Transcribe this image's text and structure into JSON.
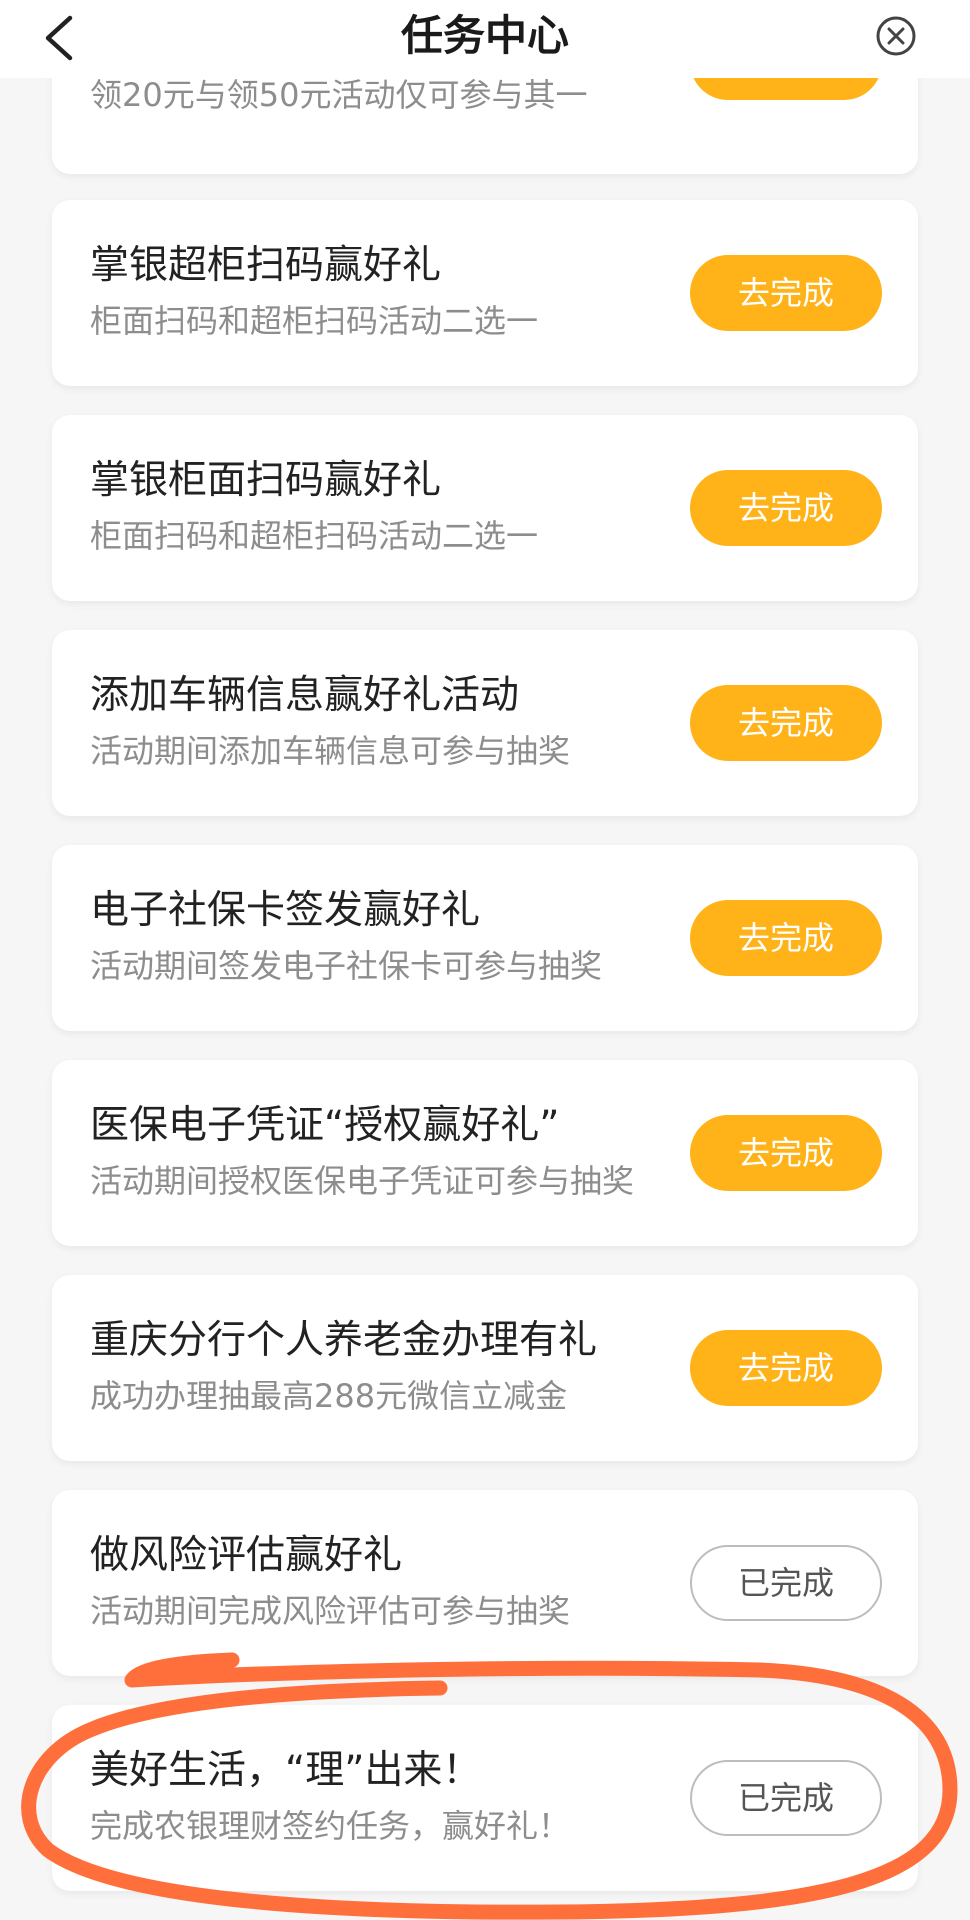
{
  "header": {
    "title": "任务中心",
    "back_icon": "chevron-left-icon",
    "close_icon": "close-circle-icon"
  },
  "colors": {
    "accent": "#ffb319",
    "annotation": "#ff6f3c"
  },
  "tasks": [
    {
      "title": "",
      "subtitle": "领20元与领50元活动仅可参与其一",
      "button": "",
      "status": "todo"
    },
    {
      "title": "掌银超柜扫码赢好礼",
      "subtitle": "柜面扫码和超柜扫码活动二选一",
      "button": "去完成",
      "status": "todo"
    },
    {
      "title": "掌银柜面扫码赢好礼",
      "subtitle": "柜面扫码和超柜扫码活动二选一",
      "button": "去完成",
      "status": "todo"
    },
    {
      "title": "添加车辆信息赢好礼活动",
      "subtitle": "活动期间添加车辆信息可参与抽奖",
      "button": "去完成",
      "status": "todo"
    },
    {
      "title": "电子社保卡签发赢好礼",
      "subtitle": "活动期间签发电子社保卡可参与抽奖",
      "button": "去完成",
      "status": "todo"
    },
    {
      "title": "医保电子凭证“授权赢好礼”",
      "subtitle": "活动期间授权医保电子凭证可参与抽奖",
      "button": "去完成",
      "status": "todo"
    },
    {
      "title": "重庆分行个人养老金办理有礼",
      "subtitle": "成功办理抽最高288元微信立减金",
      "button": "去完成",
      "status": "todo"
    },
    {
      "title": "做风险评估赢好礼",
      "subtitle": "活动期间完成风险评估可参与抽奖",
      "button": "已完成",
      "status": "done"
    },
    {
      "title": "美好生活，“理”出来！",
      "subtitle": "完成农银理财签约任务，赢好礼！",
      "button": "已完成",
      "status": "done"
    }
  ]
}
